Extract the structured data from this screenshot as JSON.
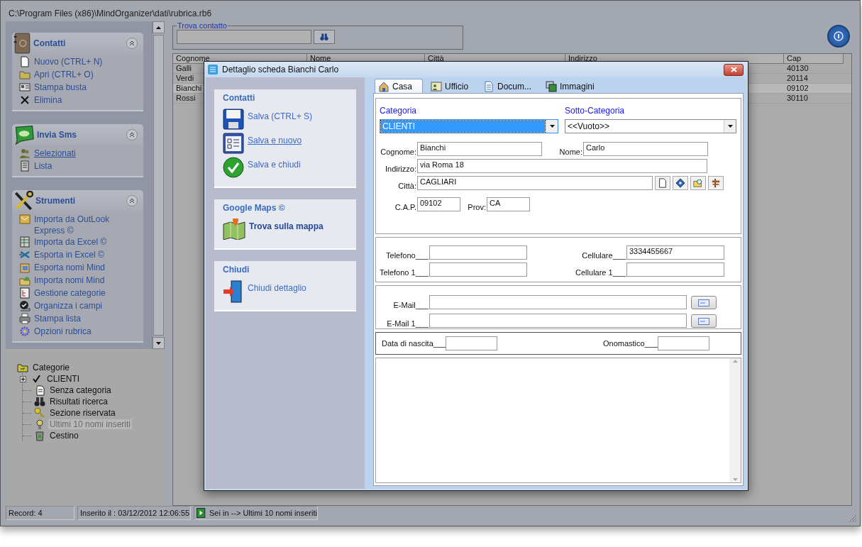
{
  "window": {
    "title": "C:\\Program Files (x86)\\MindOrganizer\\dati\\rubrica.rb6"
  },
  "sidebar": {
    "groups": [
      {
        "title": "Contatti",
        "expanded": true,
        "items": [
          {
            "label": "Nuovo (CTRL+ N)",
            "hovered": false
          },
          {
            "label": "Apri (CTRL+ O)",
            "hovered": false
          },
          {
            "label": "Stampa busta",
            "hovered": false
          },
          {
            "label": "Elimina",
            "hovered": false
          }
        ]
      },
      {
        "title": "Invia Sms",
        "expanded": true,
        "items": [
          {
            "label": "Selezionati",
            "hovered": true
          },
          {
            "label": "Lista",
            "hovered": false
          }
        ]
      },
      {
        "title": "Strumenti",
        "expanded": true,
        "items": [
          {
            "label": "Importa da OutLook Express ©",
            "hovered": false
          },
          {
            "label": "Importa da Excel ©",
            "hovered": false
          },
          {
            "label": "Esporta in Excel ©",
            "hovered": false
          },
          {
            "label": "Esporta nomi Mind",
            "hovered": false
          },
          {
            "label": "Importa nomi Mind",
            "hovered": false
          },
          {
            "label": "Gestione categorie",
            "hovered": false
          },
          {
            "label": "Organizza i campi",
            "hovered": false
          },
          {
            "label": "Stampa lista",
            "hovered": false
          },
          {
            "label": "Opzioni rubrica",
            "hovered": false
          }
        ]
      }
    ]
  },
  "tree": {
    "label": "Categorie",
    "children": [
      {
        "label": "CLIENTI",
        "expanded": false,
        "selected": false
      },
      {
        "label": "Senza categoria",
        "selected": false
      },
      {
        "label": "Risultati ricerca",
        "selected": false
      },
      {
        "label": "Sezione riservata",
        "selected": false
      },
      {
        "label": "Ultimi 10 nomi inseriti",
        "selected": true
      },
      {
        "label": "Cestino",
        "selected": false
      }
    ]
  },
  "search": {
    "legend": "Trova contatto"
  },
  "table": {
    "columns": [
      "Cognome",
      "Nome",
      "Città",
      "Indirizzo",
      "Cap"
    ],
    "rows": [
      {
        "cognome": "Galli",
        "cap": "40130",
        "selected": false
      },
      {
        "cognome": "Verdi",
        "cap": "20114",
        "selected": false
      },
      {
        "cognome": "Bianchi",
        "cap": "09102",
        "selected": true
      },
      {
        "cognome": "Rossi",
        "cap": "30110",
        "selected": false
      }
    ]
  },
  "status_bar": [
    "Record: 4",
    "Inserito il : 03/12/2012 12:06:55",
    "Sei in --> Ultimi 10 nomi inseriti"
  ],
  "dialog": {
    "title": "Dettaglio scheda Bianchi Carlo",
    "sections": [
      {
        "title": "Contatti",
        "items": [
          {
            "label": "Salva (CTRL+ S)",
            "bold": false,
            "hovered": false
          },
          {
            "label": "Salva e nuovo",
            "bold": false,
            "hovered": true
          },
          {
            "label": "Salva e chiudi",
            "bold": false,
            "hovered": false
          }
        ]
      },
      {
        "title": "Google Maps ©",
        "items": [
          {
            "label": "Trova sulla mappa",
            "bold": true,
            "hovered": false
          }
        ]
      },
      {
        "title": "Chiudi",
        "items": [
          {
            "label": "Chiudi dettaglio",
            "bold": false,
            "hovered": false
          }
        ]
      }
    ],
    "tabs": [
      {
        "label": "Casa",
        "selected": true
      },
      {
        "label": "Ufficio",
        "selected": false
      },
      {
        "label": "Docum...",
        "selected": false
      },
      {
        "label": "Immagini",
        "selected": false
      }
    ],
    "category": {
      "label": "Categoria",
      "value": "CLIENTI",
      "focused": true
    },
    "subcategory": {
      "label": "Sotto-Categoria",
      "value": "<<Vuoto>>",
      "focused": false
    },
    "surname": {
      "label": "Cognome:",
      "value": "Bianchi"
    },
    "name": {
      "label": "Nome:",
      "value": "Carlo"
    },
    "address": {
      "label": "Indirizzo:",
      "value": "via Roma 18"
    },
    "city": {
      "label": "Città:",
      "value": "CAGLIARI"
    },
    "cap": {
      "label": "C.A.P.",
      "value": "09102"
    },
    "province": {
      "label": "Prov:",
      "value": "CA"
    },
    "phones": [
      {
        "label": "Telefono___"
      },
      {
        "label": "Cellulare___",
        "value": "3334455667"
      },
      {
        "label": "Telefono 1___"
      },
      {
        "label": "Cellulare 1___"
      }
    ],
    "emails": [
      {
        "label": "E-Mail___"
      },
      {
        "label": "E-Mail 1___"
      }
    ],
    "birth_date": {
      "label": "Data di nascita___"
    },
    "name_day": {
      "label": "Onomastico___"
    }
  }
}
